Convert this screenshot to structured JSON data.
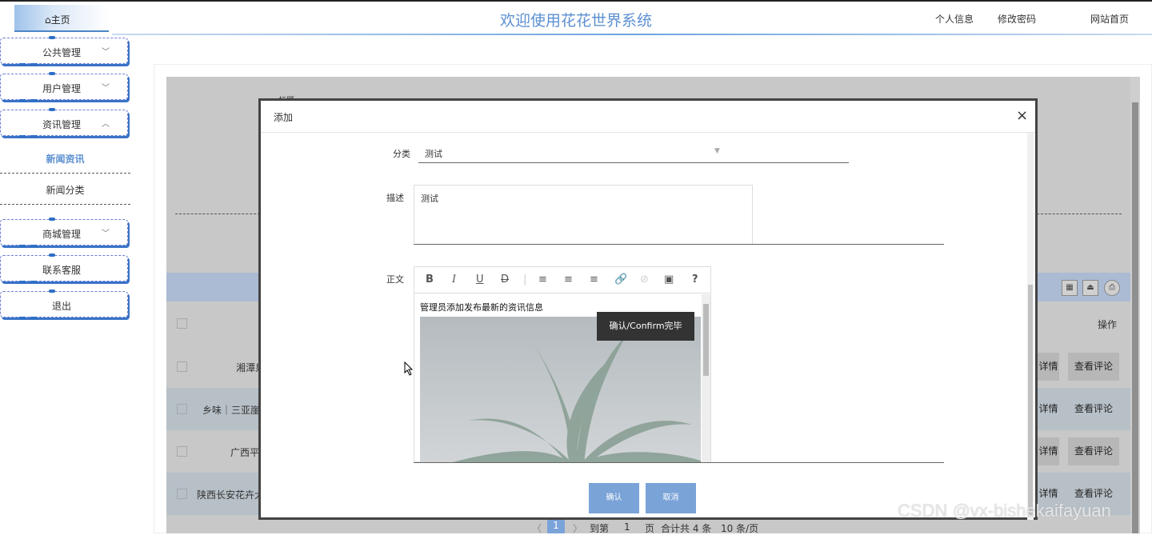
{
  "header": {
    "home_label": "⌂主页",
    "title": "欢迎使用花花世界系统",
    "nav": [
      "个人信息",
      "修改密码",
      "网站首页"
    ]
  },
  "sidebar": {
    "public": "公共管理",
    "user": "用户管理",
    "news": "资讯管理",
    "news_sub": [
      "新闻资讯",
      "新闻分类"
    ],
    "shop": "商城管理",
    "service": "联系客服",
    "logout": "退出"
  },
  "background_table": {
    "col_title": "标题",
    "col_ops": "操作",
    "rows": [
      {
        "title": "湘潭泉",
        "btn_detail": "详情",
        "btn_comment": "查看评论"
      },
      {
        "title": "乡味｜三亚崖",
        "btn_detail": "详情",
        "btn_comment": "查看评论"
      },
      {
        "title": "广西平",
        "btn_detail": "详情",
        "btn_comment": "查看评论"
      },
      {
        "title": "陕西长安花卉大",
        "btn_detail": "详情",
        "btn_comment": "查看评论"
      }
    ],
    "pager": {
      "prev": "〈",
      "page": "1",
      "next": "〉",
      "goto": "到第",
      "page_input": "1",
      "page_unit": "页",
      "total": "合计共 4 条",
      "size": "10 条/页"
    }
  },
  "modal": {
    "title": "添加",
    "close": "×",
    "category_label": "分类",
    "category_value": "测试",
    "desc_label": "描述",
    "desc_value": "测试",
    "body_label": "正文",
    "editor_text": "管理员添加发布最新的资讯信息",
    "tooltip": "确认/Confirm完毕",
    "confirm": "确认",
    "cancel": "取消"
  },
  "watermark": "CSDN @vx-bishekaifayuan"
}
